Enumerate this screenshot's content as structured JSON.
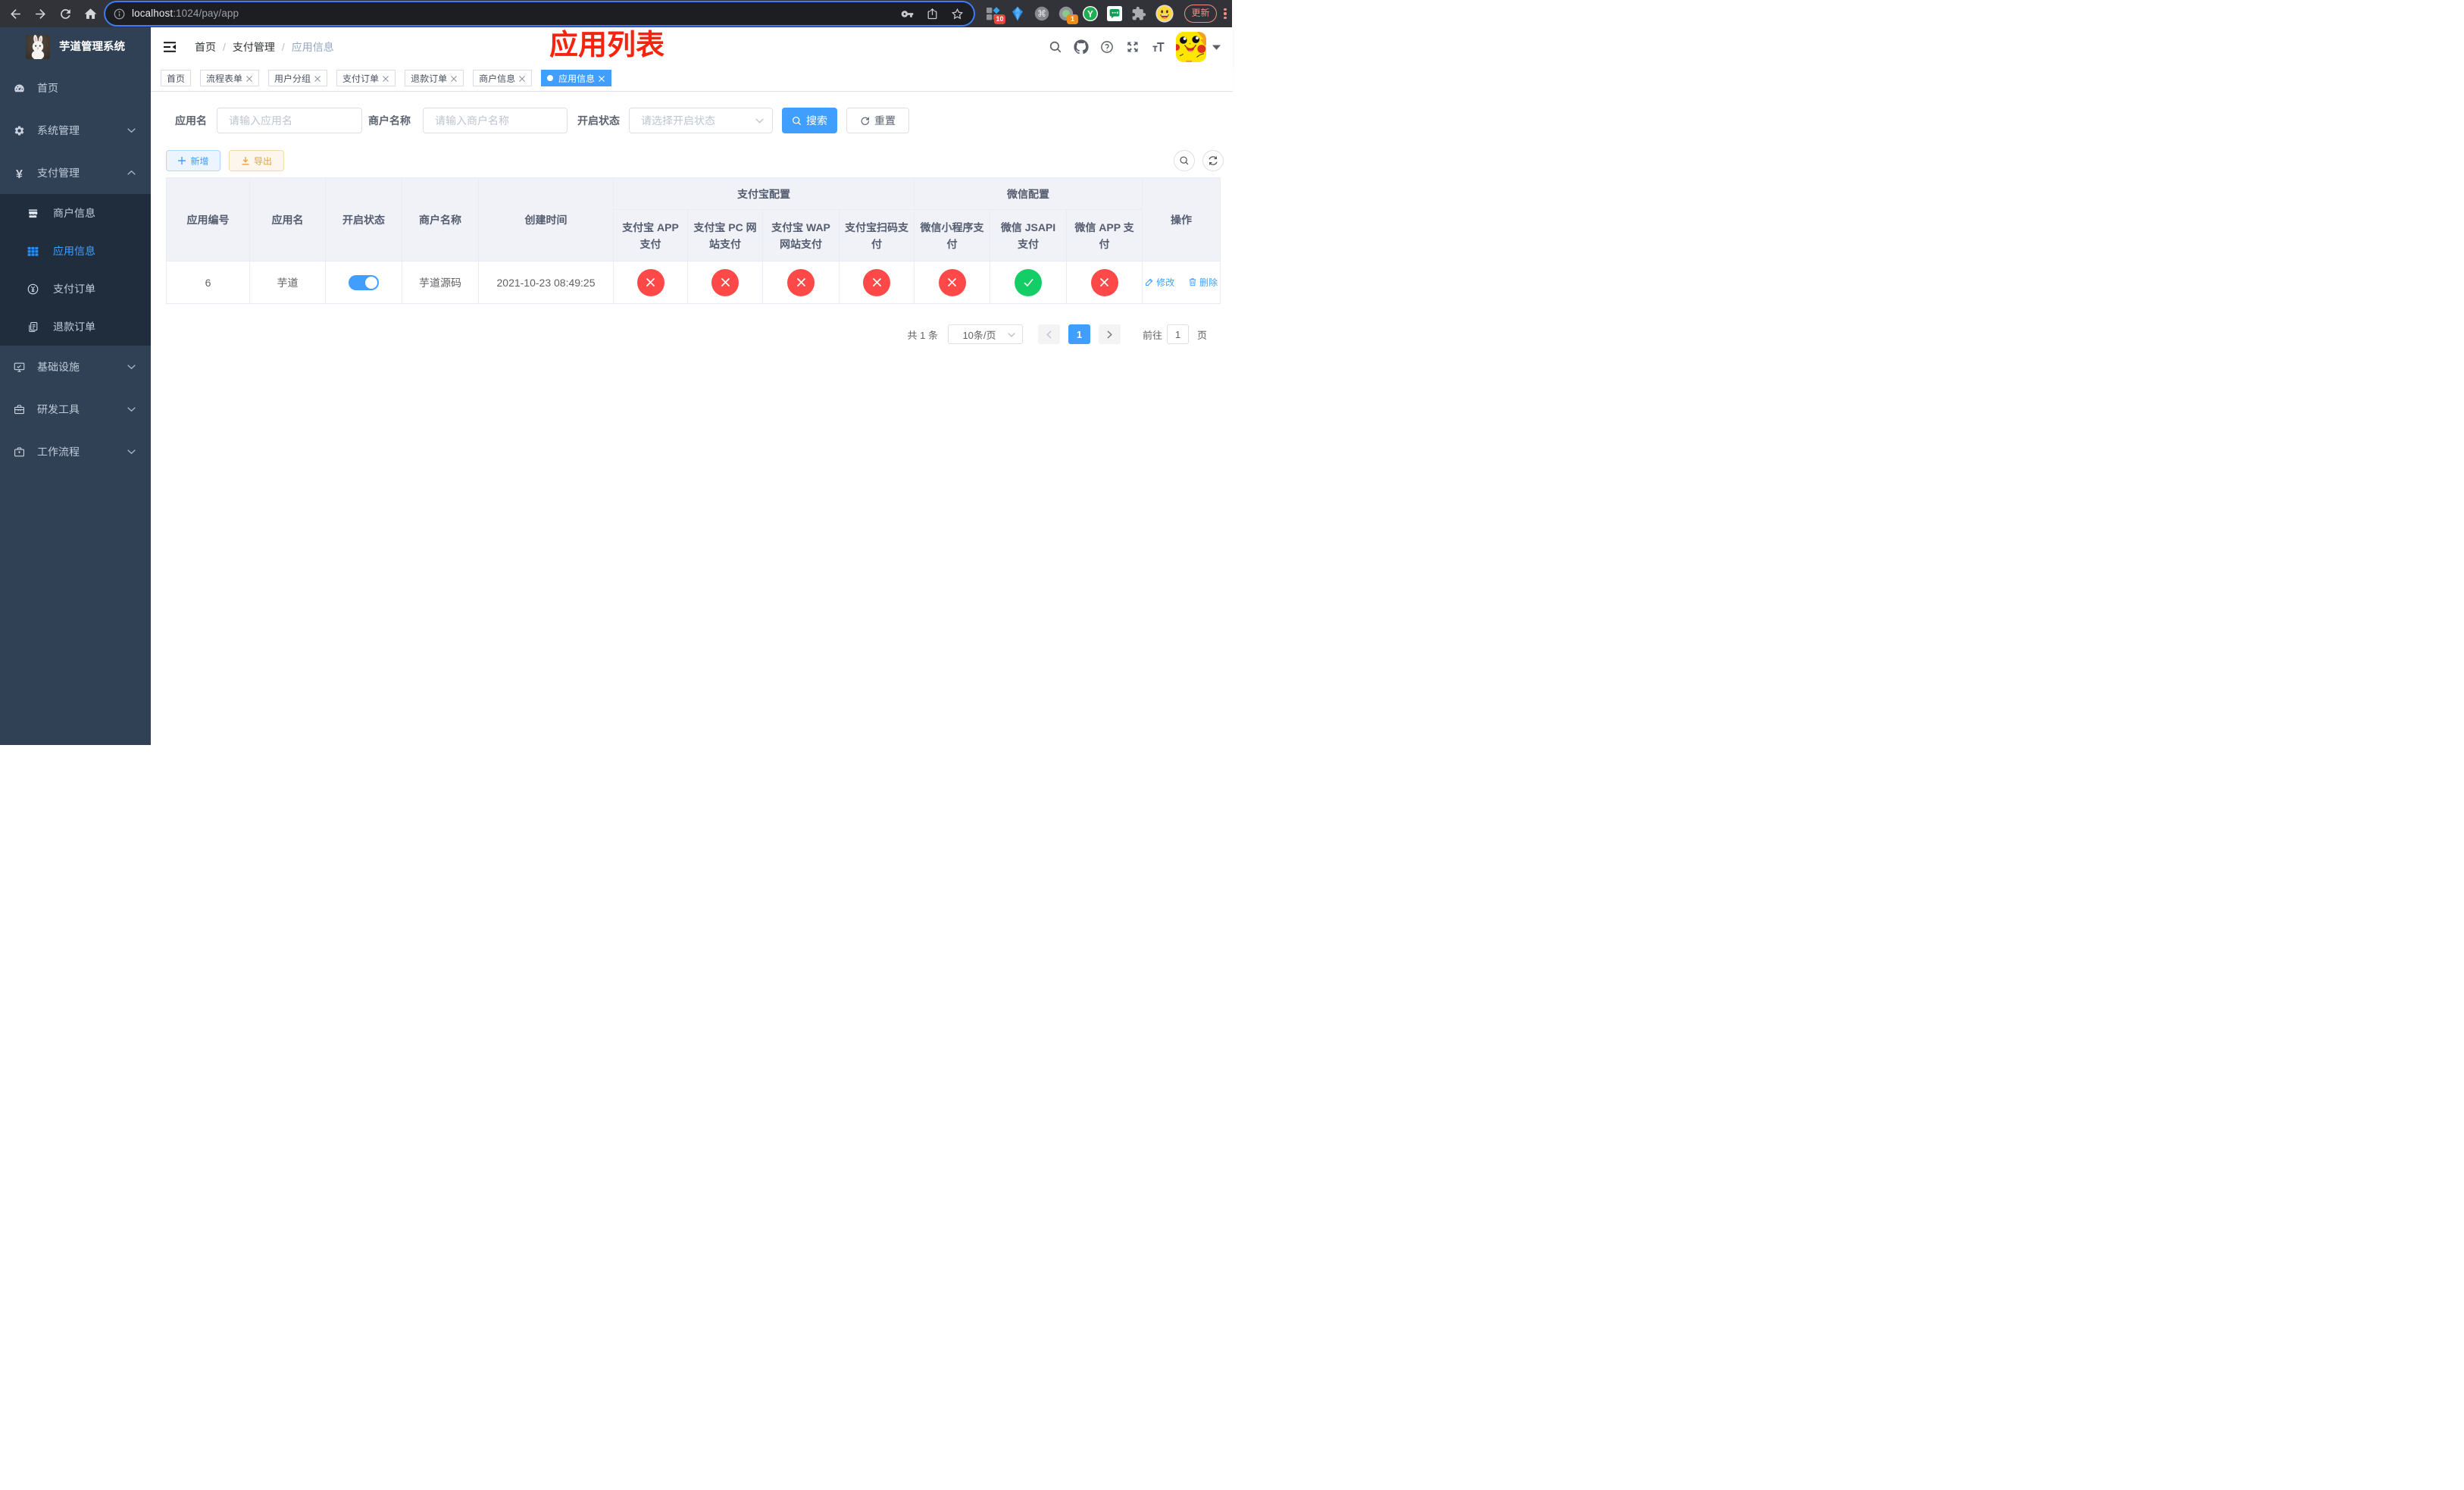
{
  "colors": {
    "accent": "#409eff",
    "danger": "#ff4949",
    "success": "#13ce66",
    "annotation_red": "#f6230e",
    "sidebar_bg": "#304156",
    "submenu_bg": "#1f2d3d",
    "warning": "#e6a23c"
  },
  "browser": {
    "url_host": "localhost",
    "url_path": ":1024/pay/app",
    "update_label": "更新",
    "ext_badge_count": "10",
    "ext_badge_count2": "1",
    "ext_y_label": "Y"
  },
  "sidebar": {
    "logo_title": "芋道管理系统",
    "items": [
      {
        "label": "首页"
      },
      {
        "label": "系统管理"
      },
      {
        "label": "支付管理"
      },
      {
        "label": "商户信息"
      },
      {
        "label": "应用信息"
      },
      {
        "label": "支付订单"
      },
      {
        "label": "退款订单"
      },
      {
        "label": "基础设施"
      },
      {
        "label": "研发工具"
      },
      {
        "label": "工作流程"
      }
    ]
  },
  "navbar": {
    "breadcrumb": [
      "首页",
      "支付管理",
      "应用信息"
    ]
  },
  "annotation": "应用列表",
  "tabs": [
    {
      "label": "首页"
    },
    {
      "label": "流程表单"
    },
    {
      "label": "用户分组"
    },
    {
      "label": "支付订单"
    },
    {
      "label": "退款订单"
    },
    {
      "label": "商户信息"
    },
    {
      "label": "应用信息"
    }
  ],
  "filter": {
    "app_name_label": "应用名",
    "app_name_placeholder": "请输入应用名",
    "merchant_label": "商户名称",
    "merchant_placeholder": "请输入商户名称",
    "status_label": "开启状态",
    "status_placeholder": "请选择开启状态",
    "search_label": "搜索",
    "reset_label": "重置"
  },
  "toolbar": {
    "add_label": "新增",
    "export_label": "导出"
  },
  "table": {
    "headers": {
      "id": "应用编号",
      "name": "应用名",
      "status": "开启状态",
      "merchant": "商户名称",
      "created": "创建时间",
      "alipay_group": "支付宝配置",
      "wechat_group": "微信配置",
      "alipay_app": "支付宝 APP 支付",
      "alipay_pc": "支付宝 PC 网站支付",
      "alipay_wap": "支付宝 WAP 网站支付",
      "alipay_qr": "支付宝扫码支付",
      "wechat_mini": "微信小程序支付",
      "wechat_jsapi": "微信 JSAPI 支付",
      "wechat_app": "微信 APP 支付",
      "actions": "操作"
    },
    "row": {
      "id": "6",
      "name": "芋道",
      "status_on": true,
      "merchant": "芋道源码",
      "created_at": "2021-10-23 08:49:25",
      "channels": [
        false,
        false,
        false,
        false,
        false,
        true,
        false
      ],
      "edit_label": "修改",
      "delete_label": "删除"
    }
  },
  "pagination": {
    "total": "共 1 条",
    "page_size": "10条/页",
    "current_page": "1",
    "goto_label": "前往",
    "goto_value": "1",
    "unit_label": "页"
  }
}
